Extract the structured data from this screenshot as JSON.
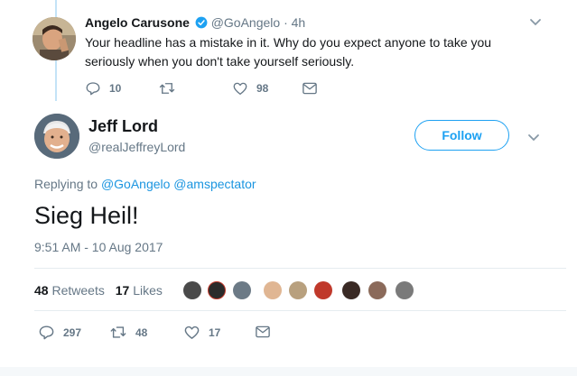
{
  "reply_tweet": {
    "name": "Angelo Carusone",
    "handle": "@GoAngelo",
    "time": "· 4h",
    "text_line1": "Your headline has a mistake in it. Why do you expect anyone to take you",
    "text_line2": "seriously when you don't take yourself seriously.",
    "reply_count": "10",
    "retweet_count": "",
    "like_count": "98",
    "verified": true
  },
  "main_tweet": {
    "name": "Jeff Lord",
    "handle": "@realJeffreyLord",
    "follow_label": "Follow",
    "replying_prefix": "Replying to",
    "replying_to": "@GoAngelo @amspectator",
    "text": "Sieg Heil!",
    "timestamp": "9:51 AM - 10 Aug 2017",
    "retweets_count": "48",
    "retweets_label": "Retweets",
    "likes_count": "17",
    "likes_label": "Likes",
    "reply_count": "297",
    "retweet_count": "48",
    "like_count": "17"
  },
  "colors": {
    "accent": "#1da1f2",
    "link": "#1b95e0",
    "muted": "#657786",
    "reply_line": "#c4e3f7"
  },
  "icons": [
    "chevron-down-icon",
    "verified-badge-icon",
    "reply-icon",
    "retweet-icon",
    "like-icon",
    "dm-icon"
  ],
  "liker_avatar_count": 10
}
